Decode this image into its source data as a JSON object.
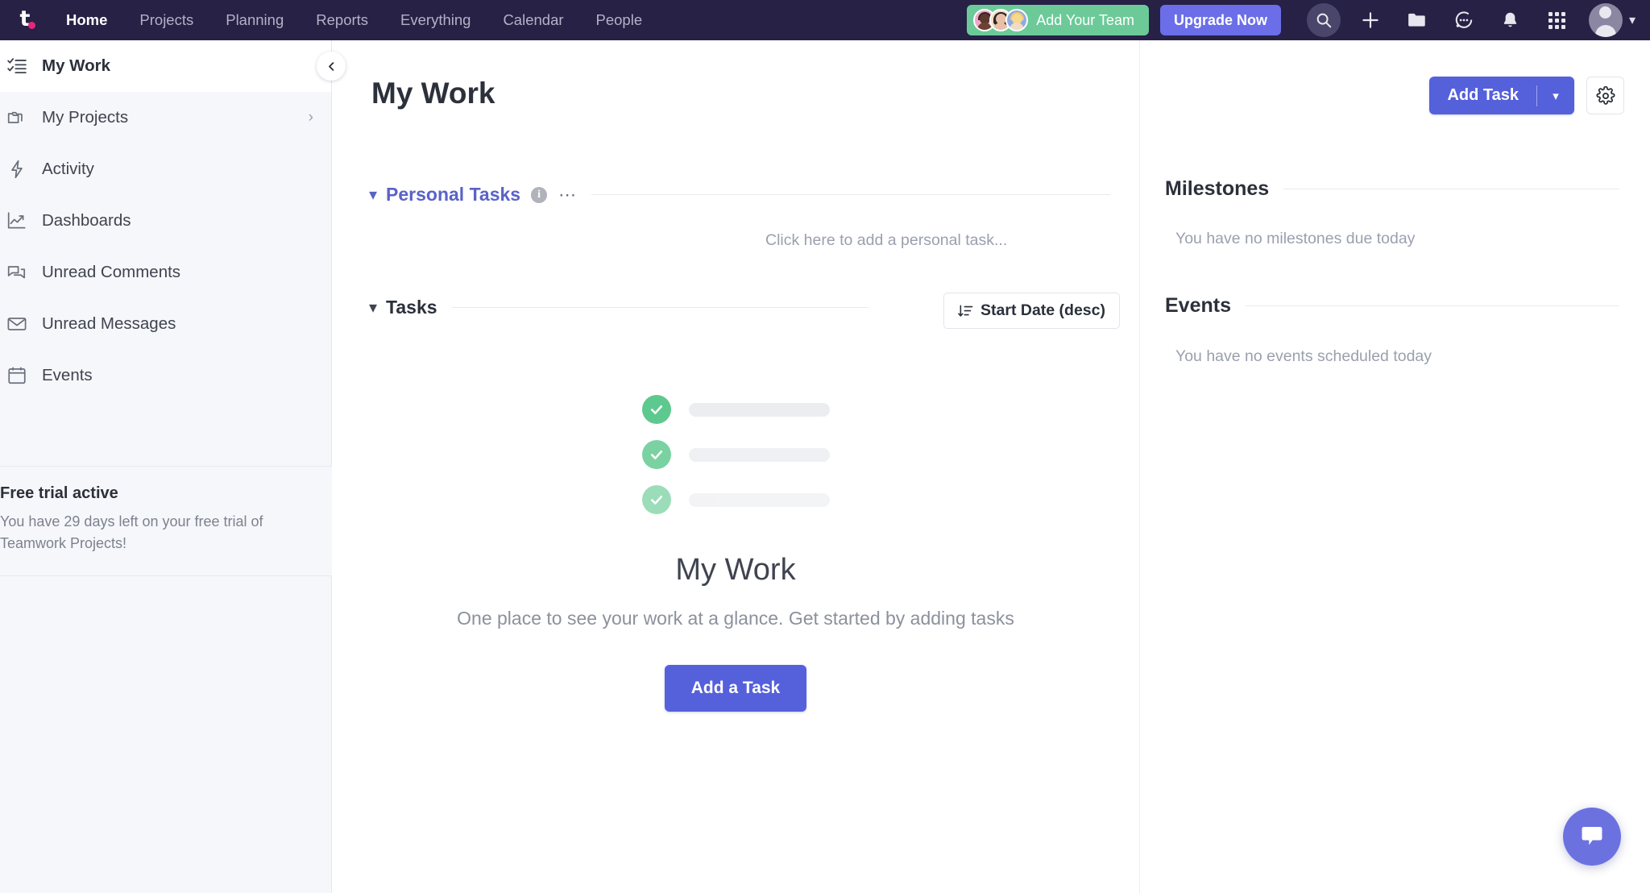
{
  "brand": {
    "logo_letter": "t",
    "accent_pink": "#e5267d",
    "nav_bg": "#262145",
    "primary": "#5560db",
    "green": "#6cca98"
  },
  "topnav": {
    "links": [
      {
        "label": "Home",
        "active": true
      },
      {
        "label": "Projects",
        "active": false
      },
      {
        "label": "Planning",
        "active": false
      },
      {
        "label": "Reports",
        "active": false
      },
      {
        "label": "Everything",
        "active": false
      },
      {
        "label": "Calendar",
        "active": false
      },
      {
        "label": "People",
        "active": false
      }
    ],
    "add_team_label": "Add Your Team",
    "upgrade_label": "Upgrade Now",
    "icons": [
      "search-icon",
      "plus-icon",
      "folder-icon",
      "chat-icon",
      "bell-icon",
      "apps-grid-icon",
      "avatar",
      "chevron-down-icon"
    ]
  },
  "sidebar": {
    "items": [
      {
        "label": "My Work",
        "icon": "checklist-icon",
        "active": true,
        "has_chevron": false
      },
      {
        "label": "My Projects",
        "icon": "folders-icon",
        "active": false,
        "has_chevron": true
      },
      {
        "label": "Activity",
        "icon": "lightning-icon",
        "active": false,
        "has_chevron": false
      },
      {
        "label": "Dashboards",
        "icon": "chart-icon",
        "active": false,
        "has_chevron": false
      },
      {
        "label": "Unread Comments",
        "icon": "comments-icon",
        "active": false,
        "has_chevron": false
      },
      {
        "label": "Unread Messages",
        "icon": "envelope-icon",
        "active": false,
        "has_chevron": false
      },
      {
        "label": "Events",
        "icon": "calendar-icon",
        "active": false,
        "has_chevron": false
      }
    ],
    "trial": {
      "title": "Free trial active",
      "description": "You have 29 days left on your free trial of Teamwork Projects!"
    },
    "collapse_icon": "chevron-left-icon"
  },
  "main": {
    "page_title": "My Work",
    "add_task_label": "Add Task",
    "add_task_caret_icon": "chevron-down-icon",
    "settings_icon": "gear-icon",
    "personal_tasks": {
      "title": "Personal Tasks",
      "info_icon": "info-icon",
      "more_icon": "ellipsis-icon",
      "collapse_icon": "chevron-down-icon",
      "add_placeholder": "Click here to add a personal task..."
    },
    "tasks": {
      "title": "Tasks",
      "collapse_icon": "chevron-down-icon",
      "sort_label": "Start Date (desc)",
      "sort_icon": "sort-desc-icon"
    },
    "empty_state": {
      "title": "My Work",
      "subtitle": "One place to see your work at a glance. Get started by adding tasks",
      "cta_label": "Add a Task",
      "skeleton_rows": 3,
      "check_icon": "check-circle-icon"
    }
  },
  "right_panel": {
    "sections": [
      {
        "title": "Milestones",
        "empty_text": "You have no milestones due today"
      },
      {
        "title": "Events",
        "empty_text": "You have no events scheduled today"
      }
    ]
  },
  "chat_fab": {
    "icon": "chat-bubble-icon"
  }
}
